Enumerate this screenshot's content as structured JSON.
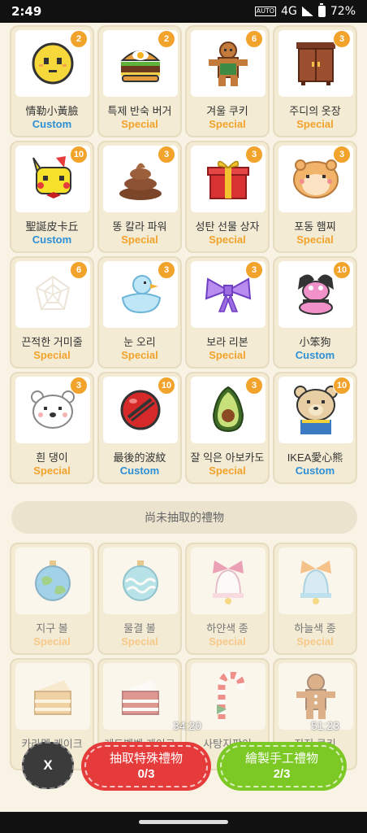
{
  "status": {
    "time": "2:49",
    "auto": "AUTO",
    "network": "4G",
    "battery": "72%"
  },
  "collected": [
    {
      "name": "情勒小黃臉",
      "type": "Custom",
      "count": "2",
      "icon": "yellow-face-icon"
    },
    {
      "name": "특제 반숙 버거",
      "type": "Special",
      "count": "2",
      "icon": "burger-icon"
    },
    {
      "name": "겨울 쿠키",
      "type": "Special",
      "count": "6",
      "icon": "gingerbread-cookie-icon"
    },
    {
      "name": "주디의 옷장",
      "type": "Special",
      "count": "3",
      "icon": "wardrobe-icon"
    },
    {
      "name": "聖誕皮卡丘",
      "type": "Custom",
      "count": "10",
      "icon": "christmas-pikachu-icon"
    },
    {
      "name": "똥 칼라 파워",
      "type": "Special",
      "count": "3",
      "icon": "poop-icon"
    },
    {
      "name": "성탄 선물 상자",
      "type": "Special",
      "count": "3",
      "icon": "gift-box-icon"
    },
    {
      "name": "포동 햄찌",
      "type": "Special",
      "count": "3",
      "icon": "hamster-icon"
    },
    {
      "name": "끈적한 거미줄",
      "type": "Special",
      "count": "6",
      "icon": "spider-web-icon"
    },
    {
      "name": "눈 오리",
      "type": "Special",
      "count": "3",
      "icon": "snow-duck-icon"
    },
    {
      "name": "보라 리본",
      "type": "Special",
      "count": "3",
      "icon": "purple-ribbon-icon"
    },
    {
      "name": "小笨狗",
      "type": "Custom",
      "count": "10",
      "icon": "pink-dog-icon"
    },
    {
      "name": "흰 댕이",
      "type": "Special",
      "count": "3",
      "icon": "white-dog-icon"
    },
    {
      "name": "最後的波紋",
      "type": "Custom",
      "count": "10",
      "icon": "red-ball-icon"
    },
    {
      "name": "잘 익은 아보카도",
      "type": "Special",
      "count": "3",
      "icon": "avocado-icon"
    },
    {
      "name": "IKEA愛心熊",
      "type": "Custom",
      "count": "10",
      "icon": "teddy-bear-icon"
    }
  ],
  "section_title": "尚未抽取的禮物",
  "uncollected": [
    {
      "name": "지구 볼",
      "type": "Special",
      "icon": "earth-ornament-icon"
    },
    {
      "name": "물결 볼",
      "type": "Special",
      "icon": "wave-ornament-icon"
    },
    {
      "name": "하얀색 종",
      "type": "Special",
      "icon": "white-bell-icon"
    },
    {
      "name": "하늘색 종",
      "type": "Special",
      "icon": "sky-bell-icon"
    },
    {
      "name": "카라멜 케이크",
      "type": "",
      "icon": "caramel-cake-icon"
    },
    {
      "name": "레드벨벳 케이크",
      "type": "",
      "icon": "red-velvet-cake-icon"
    },
    {
      "name": "사탕지팡이",
      "type": "",
      "icon": "candy-cane-icon"
    },
    {
      "name": "진저 쿠키",
      "type": "",
      "icon": "ginger-cookie-icon"
    }
  ],
  "timers": {
    "left": "34:20",
    "right": "51:23"
  },
  "actions": {
    "close_label": "X",
    "special": {
      "label": "抽取特殊禮物",
      "count": "0/3",
      "color": "#e53b3b"
    },
    "custom": {
      "label": "繪製手工禮物",
      "count": "2/3",
      "color": "#7cc824"
    }
  }
}
